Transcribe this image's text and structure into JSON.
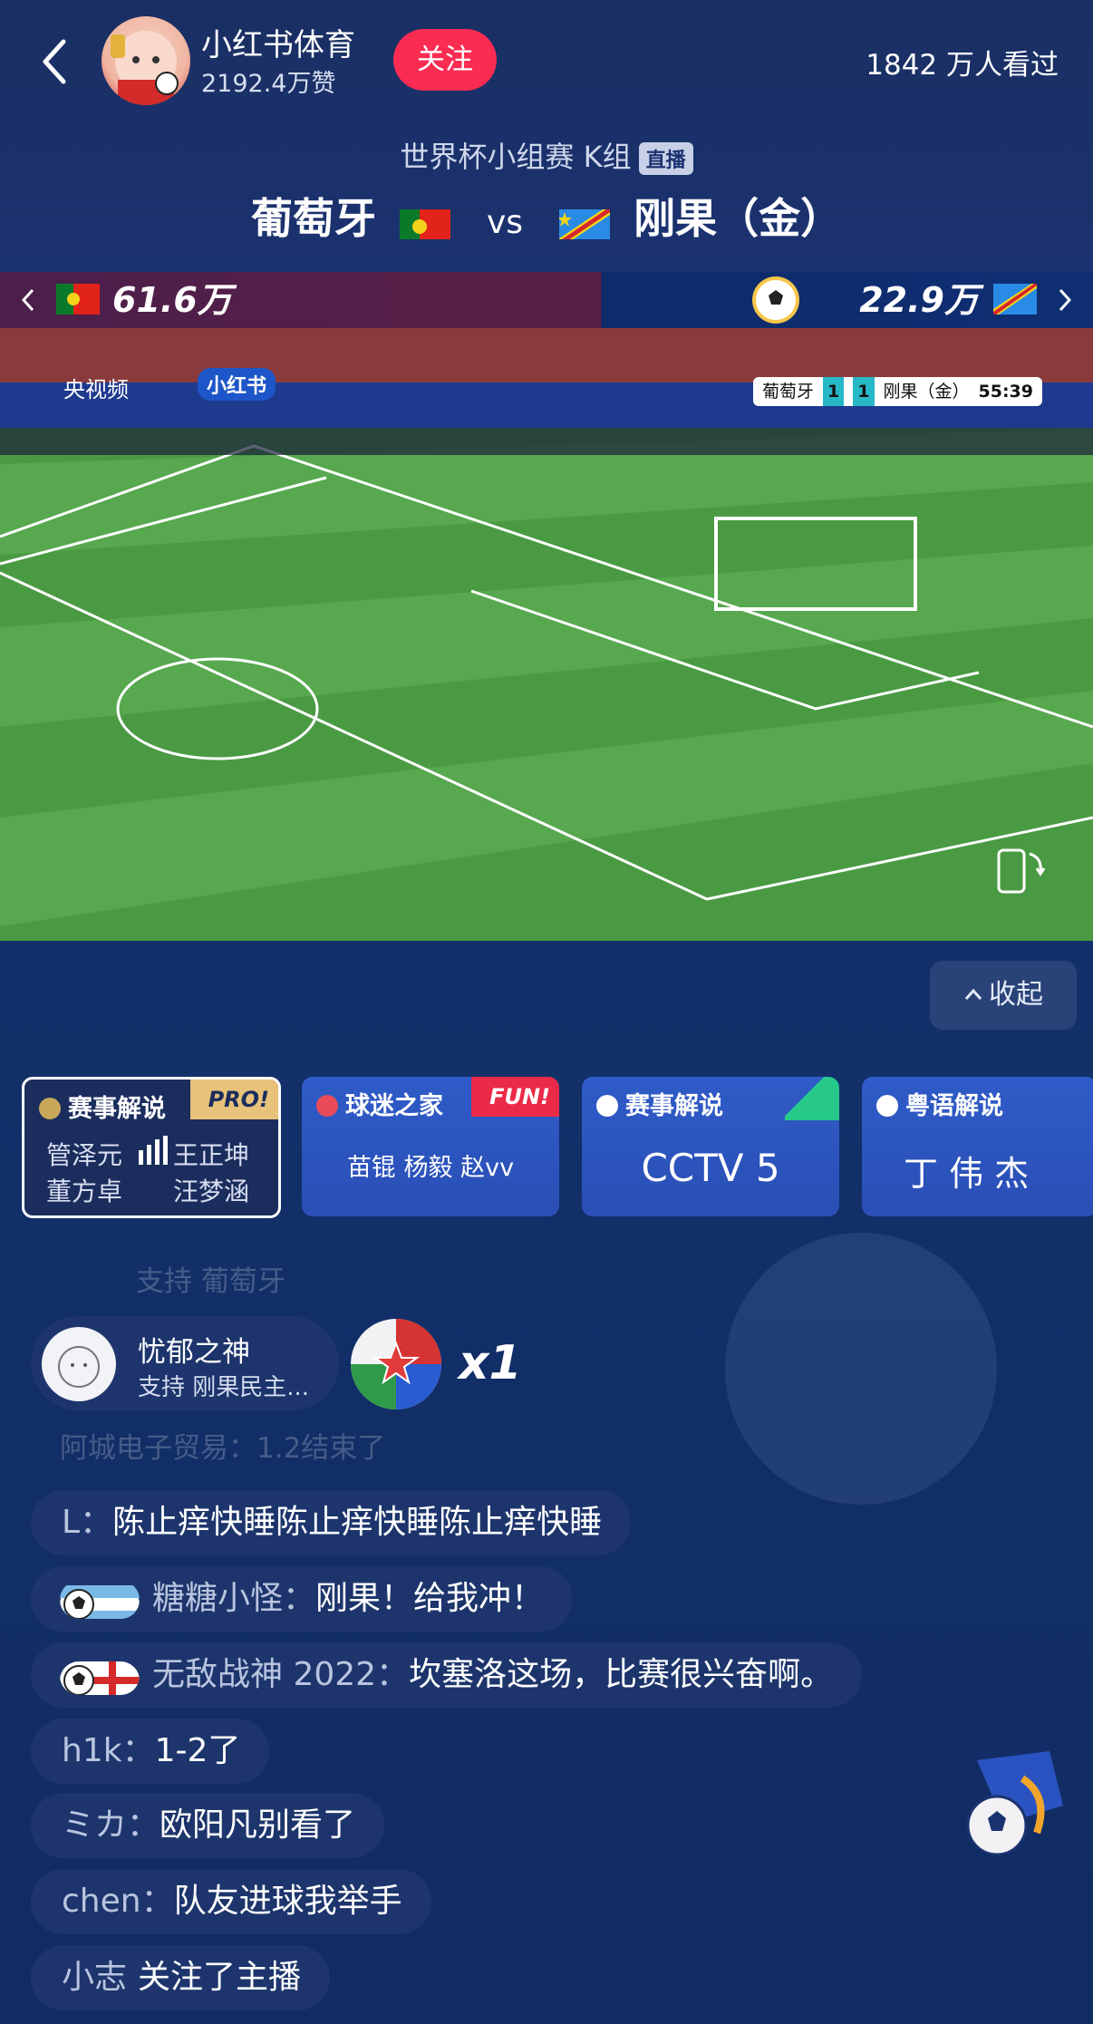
{
  "header": {
    "host_name": "小红书体育",
    "host_likes": "2192.4万赞",
    "follow_label": "关注",
    "viewers": "1842 万人看过"
  },
  "match": {
    "subtitle": "世界杯小组赛 K组",
    "live_tag": "直播",
    "team_home": "葡萄牙",
    "vs": "vs",
    "team_away": "刚果（金）"
  },
  "support": {
    "home_count": "61.6万",
    "away_count": "22.9万"
  },
  "video": {
    "broadcaster": "央视频",
    "platform_chip": "小红书",
    "score": {
      "home_name": "葡萄牙",
      "home_score": "1",
      "away_score": "1",
      "away_name": "刚果（金）",
      "clock": "55:39"
    }
  },
  "collapse_label": "收起",
  "commentary_cards": [
    {
      "title": "赛事解说",
      "badge": "PRO!",
      "line1": "管泽元",
      "line1b": "王正坤",
      "line2": "董方卓",
      "line2b": "汪梦涵",
      "selected": true
    },
    {
      "title": "球迷之家",
      "badge": "FUN!",
      "body": "苗锟 杨毅 赵vv"
    },
    {
      "title": "赛事解说",
      "body": "CCTV 5"
    },
    {
      "title": "粤语解说",
      "body": "丁  伟  杰"
    }
  ],
  "chat": {
    "faded_top": "支持 葡萄牙",
    "gift": {
      "user": "忧郁之神",
      "sub": "支持 刚果民主...",
      "count": "x1"
    },
    "faded_mid": "阿城电子贸易：1.2结束了",
    "messages": [
      {
        "user": "L：",
        "text": "陈止痒快睡陈止痒快睡陈止痒快睡"
      },
      {
        "user": "糖糖小怪：",
        "text": "刚果！给我冲！"
      },
      {
        "user": "无敌战神 2022：",
        "text": "坎塞洛这场，比赛很兴奋啊。"
      },
      {
        "user": "h1k：",
        "text": "1-2了"
      },
      {
        "user": "ミカ：",
        "text": "欧阳凡别看了"
      },
      {
        "user": "chen：",
        "text": "队友进球我举手"
      },
      {
        "user": "小志",
        "text": "关注了主播"
      }
    ]
  },
  "colors": {
    "follow": "#fb2c52",
    "bg": "#12306a",
    "pro_badge": "#e8c27a",
    "fun_badge": "#ea2a47"
  }
}
